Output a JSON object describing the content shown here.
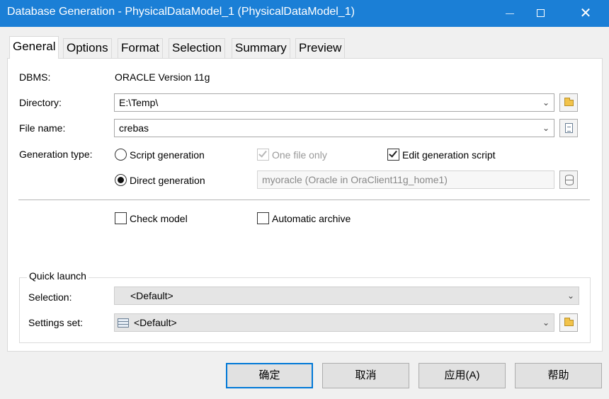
{
  "window": {
    "title": "Database Generation - PhysicalDataModel_1 (PhysicalDataModel_1)",
    "minimize_glyph": "—",
    "close_glyph": "✕"
  },
  "tabs": [
    {
      "label": "General",
      "active": true
    },
    {
      "label": "Options"
    },
    {
      "label": "Format"
    },
    {
      "label": "Selection"
    },
    {
      "label": "Summary"
    },
    {
      "label": "Preview"
    }
  ],
  "general": {
    "dbms_label": "DBMS:",
    "dbms_value": "ORACLE Version 11g",
    "directory_label": "Directory:",
    "directory_value": "E:\\Temp\\",
    "filename_label": "File name:",
    "filename_value": "crebas",
    "gentype_label": "Generation type:",
    "script_generation_label": "Script generation",
    "direct_generation_label": "Direct generation",
    "one_file_only_label": "One file only",
    "edit_generation_script_label": "Edit generation script",
    "connection_value": "myoracle (Oracle in OraClient11g_home1)",
    "check_model_label": "Check model",
    "automatic_archive_label": "Automatic archive",
    "selected_generation_type": "Direct generation",
    "one_file_only_checked": true,
    "edit_generation_script_checked": true,
    "check_model_checked": false,
    "automatic_archive_checked": false
  },
  "quick_launch": {
    "legend": "Quick launch",
    "selection_label": "Selection:",
    "selection_value": "<Default>",
    "settings_label": "Settings set:",
    "settings_value": "<Default>"
  },
  "buttons": {
    "ok": "确定",
    "cancel": "取消",
    "apply": "应用(A)",
    "help": "帮助"
  },
  "icons": {
    "dropdown": "chevron-down-icon",
    "browse_folder": "folder-icon",
    "file": "document-icon",
    "datasource": "database-icon",
    "settings": "grid-icon"
  },
  "colors": {
    "titlebar": "#1b7fd6",
    "default_button_border": "#0078d7"
  }
}
